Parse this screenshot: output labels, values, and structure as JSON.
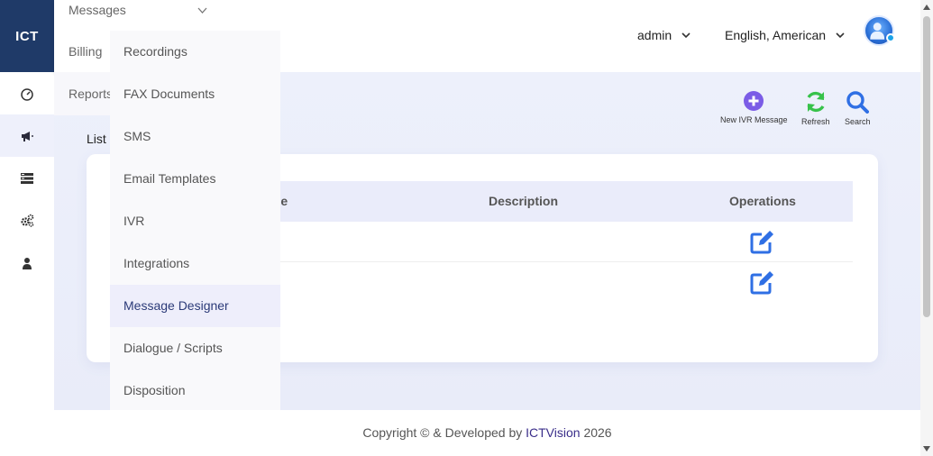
{
  "app": {
    "logo": "ICT"
  },
  "header": {
    "user": "admin",
    "language": "English, American"
  },
  "nav": {
    "messages": "Messages",
    "billing": "Billing",
    "reports": "Reports"
  },
  "dropdown": {
    "items": [
      "Recordings",
      "FAX Documents",
      "SMS",
      "Email Templates",
      "IVR",
      "Integrations",
      "Message Designer",
      "Dialogue / Scripts",
      "Disposition"
    ],
    "active_index": 6
  },
  "toolbar": {
    "new_label": "New IVR Message",
    "refresh_label": "Refresh",
    "search_label": "Search"
  },
  "page": {
    "list_title": "List"
  },
  "table": {
    "columns": [
      "Name",
      "Description",
      "Operations"
    ],
    "visible_name_header": "Name",
    "rows": [
      {
        "name": "",
        "description": ""
      },
      {
        "name": "",
        "description": ""
      }
    ]
  },
  "footer": {
    "prefix": "Copyright © & Developed by ",
    "brand": "ICTVision",
    "year": " 2026"
  },
  "colors": {
    "sidebar_logo": "#1f3a68",
    "add_icon": "#7b5ce6",
    "refresh_icon": "#37c24a",
    "search_icon": "#2f6fe4",
    "edit_icon": "#2f6fe4",
    "content_bg": "#edf0fb"
  }
}
